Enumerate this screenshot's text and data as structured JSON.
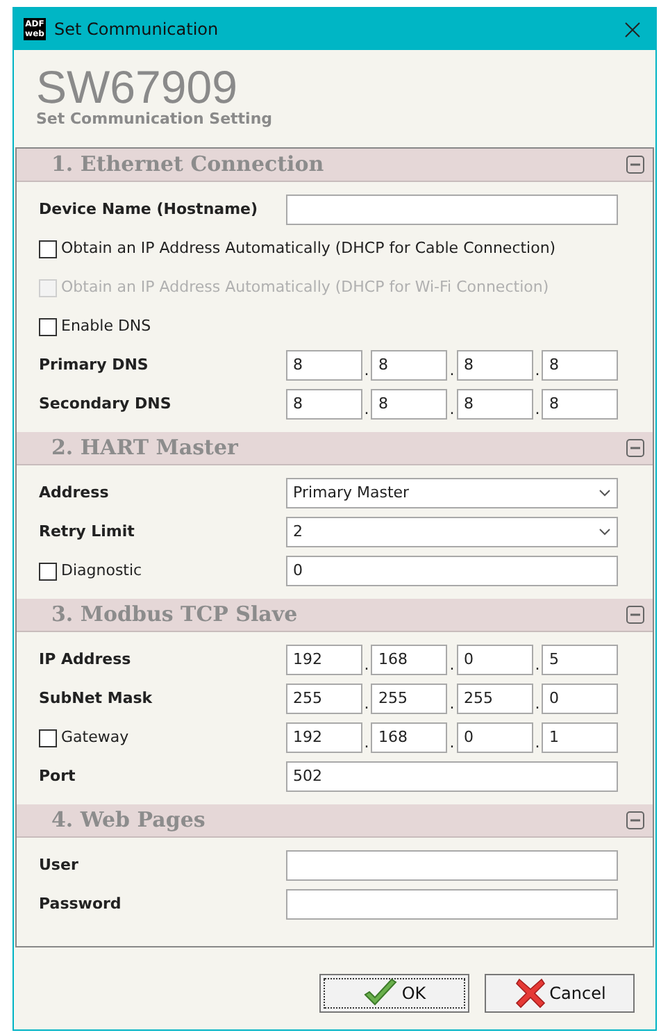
{
  "window": {
    "title": "Set Communication",
    "logo_lines": [
      "ADF",
      "web"
    ]
  },
  "header": {
    "title": "SW67909",
    "subtitle": "Set Communication Setting"
  },
  "sections": [
    {
      "title": "1. Ethernet Connection",
      "rows": [
        {
          "kind": "field",
          "label": "Device Name (Hostname)"
        },
        {
          "kind": "checkbox",
          "label": "Obtain an IP Address Automatically (DHCP for Cable Connection)",
          "checked": false,
          "disabled": false
        },
        {
          "kind": "checkbox",
          "label": "Obtain an IP Address Automatically (DHCP for Wi-Fi Connection)",
          "checked": false,
          "disabled": true
        },
        {
          "kind": "checkbox",
          "label": "Enable DNS",
          "checked": false,
          "disabled": false
        },
        {
          "kind": "ip",
          "label": "Primary DNS",
          "octets": [
            "8",
            "8",
            "8",
            "8"
          ],
          "separator": "."
        },
        {
          "kind": "ip",
          "label": "Secondary DNS",
          "octets": [
            "8",
            "8",
            "8",
            "8"
          ],
          "separator": "."
        }
      ]
    },
    {
      "title": "2. HART Master",
      "rows": [
        {
          "kind": "select",
          "label": "Address",
          "value": "Primary Master"
        },
        {
          "kind": "select",
          "label": "Retry Limit",
          "value": "2"
        },
        {
          "kind": "checkbox_field",
          "label": "Diagnostic",
          "checked": false,
          "value": "0"
        }
      ]
    },
    {
      "title": "3. Modbus TCP Slave",
      "rows": [
        {
          "kind": "ip",
          "label": "IP Address",
          "octets": [
            "192",
            "168",
            "0",
            "5"
          ],
          "separator": "."
        },
        {
          "kind": "ip",
          "label": "SubNet Mask",
          "octets": [
            "255",
            "255",
            "255",
            "0"
          ],
          "separator": "."
        },
        {
          "kind": "checkbox_ip",
          "label": "Gateway",
          "checked": false,
          "octets": [
            "192",
            "168",
            "0",
            "1"
          ],
          "separator": "."
        },
        {
          "kind": "field",
          "label": "Port",
          "value": "502"
        }
      ]
    },
    {
      "title": "4. Web Pages",
      "rows": [
        {
          "kind": "field",
          "label": "User"
        },
        {
          "kind": "field",
          "label": "Password"
        }
      ]
    }
  ],
  "buttons": [
    {
      "kind": "ok",
      "label": "OK",
      "focused": true
    },
    {
      "kind": "cancel",
      "label": "Cancel",
      "focused": false
    }
  ]
}
